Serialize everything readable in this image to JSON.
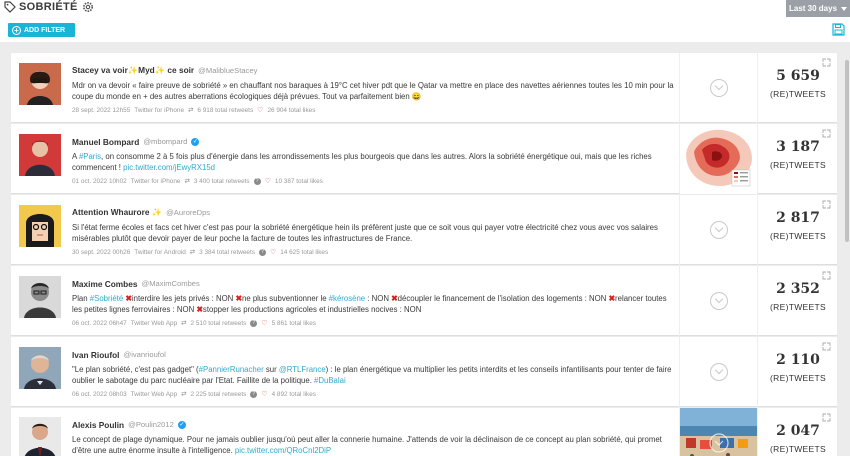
{
  "header": {
    "title": "SOBRIÉTÉ",
    "period": "Last 30 days",
    "add_filter": "ADD FILTER"
  },
  "count_label": "(RE)TWEETS",
  "tweets": [
    {
      "name": "Stacey va voir",
      "name_parts": [
        "Stacey va voir",
        "✨",
        "Myd",
        "✨",
        " ce soir"
      ],
      "handle": "@MalibluеStacey",
      "verified": false,
      "text_segments": [
        {
          "t": "Mdr on va devoir « faire preuve de sobriété » en chauffant nos baraques à 19°C cet hiver pdt que le Qatar va mettre en place des navettes aériennes toutes les 10 min pour la coupe du monde en + des autres aberrations écologiques déjà prévues. Tout va parfaitement bien 😄"
        }
      ],
      "date": "28 sept. 2022 12h55",
      "source": "Twitter for iPhone",
      "retweets": "6 918 total retweets",
      "likes": "26 904 total likes",
      "count": "5 659",
      "has_media": false
    },
    {
      "name": "Manuel Bompard",
      "handle": "@mbompard",
      "verified": true,
      "text_segments": [
        {
          "t": "A "
        },
        {
          "t": "#Paris",
          "hl": true
        },
        {
          "t": ", on consomme 2 à 5 fois plus d'énergie dans les arrondissements les plus bourgeois que dans les autres. Alors la sobriété énergétique oui, mais que les riches commencent ! "
        },
        {
          "t": "pic.twitter.com/jEwyRX15d",
          "hl": true
        }
      ],
      "date": "01 oct. 2022 10h02",
      "source": "Twitter for iPhone",
      "retweets": "3 400 total retweets",
      "likes": "10 387 total likes",
      "count": "3 187",
      "has_media": true,
      "media": "paris-energy-map"
    },
    {
      "name": "Attention Whaurore ✨",
      "handle": "@AuroreDps",
      "verified": false,
      "text_segments": [
        {
          "t": "Si l'état ferme écoles et facs cet hiver c'est pas pour la sobriété énergétique hein ils préfèrent juste que ce soit vous qui payer votre électricité chez vous avec vos salaires misérables plutôt que devoir payer de leur poche la facture de toutes les infrastructures de France."
        }
      ],
      "date": "30 sept. 2022 00h26",
      "source": "Twitter for Android",
      "retweets": "3 384 total retweets",
      "likes": "14 625 total likes",
      "count": "2 817",
      "has_media": false
    },
    {
      "name": "Maxime Combes",
      "handle": "@MaximCombes",
      "verified": false,
      "text_segments": [
        {
          "t": "Plan "
        },
        {
          "t": "#Sobriété",
          "hl": true
        },
        {
          "t": " "
        },
        {
          "t": "✖",
          "x": true
        },
        {
          "t": "interdire les jets privés : NON "
        },
        {
          "t": "✖",
          "x": true
        },
        {
          "t": "ne plus subventionner le "
        },
        {
          "t": "#kérosène",
          "hl": true
        },
        {
          "t": " : NON "
        },
        {
          "t": "✖",
          "x": true
        },
        {
          "t": "découpler le financement de l'isolation des logements : NON "
        },
        {
          "t": "✖",
          "x": true
        },
        {
          "t": "relancer toutes les petites lignes ferroviaires : NON "
        },
        {
          "t": "✖",
          "x": true
        },
        {
          "t": "stopper les productions agricoles et industrielles nocives : NON"
        }
      ],
      "date": "06 oct. 2022 06h47",
      "source": "Twitter Web App",
      "retweets": "2 510 total retweets",
      "likes": "5 861 total likes",
      "count": "2 352",
      "has_media": false
    },
    {
      "name": "Ivan Rioufol",
      "handle": "@ivanrioufol",
      "verified": false,
      "text_segments": [
        {
          "t": "\"Le plan sobriété, c'est pas gadget\" ("
        },
        {
          "t": "#PannierRunacher",
          "hl": true
        },
        {
          "t": " sur "
        },
        {
          "t": "@RTLFrance",
          "hl": true
        },
        {
          "t": ") : le plan énergétique va multiplier les petits interdits et les conseils infantilisants pour tenter de faire oublier le sabotage du parc nucléaire par l'Etat. Faillite de la politique. "
        },
        {
          "t": "#DuBalai",
          "hl": true
        }
      ],
      "date": "06 oct. 2022 08h03",
      "source": "Twitter Web App",
      "retweets": "2 225 total retweets",
      "likes": "4 892 total likes",
      "count": "2 110",
      "has_media": false
    },
    {
      "name": "Alexis Poulin",
      "handle": "@Poulin2012",
      "verified": true,
      "text_segments": [
        {
          "t": "Le concept de plage dynamique. Pour ne jamais oublier jusqu'où peut aller la connerie humaine. J'attends de voir la déclinaison de ce concept au plan sobriété, qui promet d'être une autre énorme insulte à l'intelligence. "
        },
        {
          "t": "pic.twitter.com/QRoCnl2DiP",
          "hl": true
        }
      ],
      "date": "",
      "source": "",
      "retweets": "",
      "likes": "",
      "count": "2 047",
      "has_media": true,
      "media": "beach-photo"
    }
  ],
  "colors": {
    "accent": "#1ab5d6",
    "hashtag": "#31a9cf",
    "cross": "#d32323",
    "verified": "#1da1f2",
    "heart": "#d9534f"
  }
}
